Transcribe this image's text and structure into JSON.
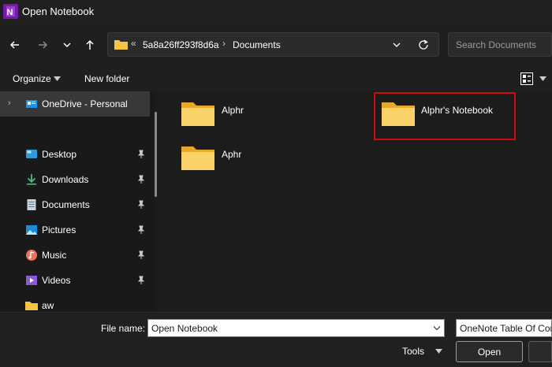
{
  "window": {
    "title": "Open Notebook"
  },
  "address": {
    "overflow_chevron": "«",
    "segments": [
      "5a8a26ff293f8d6a",
      "Documents"
    ],
    "separator": "›"
  },
  "search": {
    "placeholder": "Search Documents"
  },
  "toolbar": {
    "organize_label": "Organize",
    "new_folder_label": "New folder"
  },
  "sidebar": {
    "items": [
      {
        "label": "OneDrive - Personal",
        "icon": "onedrive-icon",
        "expand": "›",
        "selected": true
      },
      {
        "label": "Desktop",
        "icon": "desktop-icon",
        "pinned": true
      },
      {
        "label": "Downloads",
        "icon": "downloads-icon",
        "pinned": true
      },
      {
        "label": "Documents",
        "icon": "documents-icon",
        "pinned": true
      },
      {
        "label": "Pictures",
        "icon": "pictures-icon",
        "pinned": true
      },
      {
        "label": "Music",
        "icon": "music-icon",
        "pinned": true
      },
      {
        "label": "Videos",
        "icon": "videos-icon",
        "pinned": true
      },
      {
        "label": "aw",
        "icon": "folder-icon"
      }
    ]
  },
  "folders": [
    {
      "name": "Alphr",
      "icon": "folder-icon"
    },
    {
      "name": "Alphr's Notebook",
      "icon": "folder-icon",
      "highlighted": true
    },
    {
      "name": "Aphr",
      "icon": "folder-icon"
    }
  ],
  "footer": {
    "file_name_label": "File name:",
    "file_name_value": "Open Notebook",
    "file_type_value": "OneNote Table Of Contents",
    "tools_label": "Tools",
    "open_label": "Open"
  },
  "colors": {
    "accent_highlight": "#d10a11",
    "folder_yellow": "#f4c542",
    "background": "#1c1c1c"
  }
}
